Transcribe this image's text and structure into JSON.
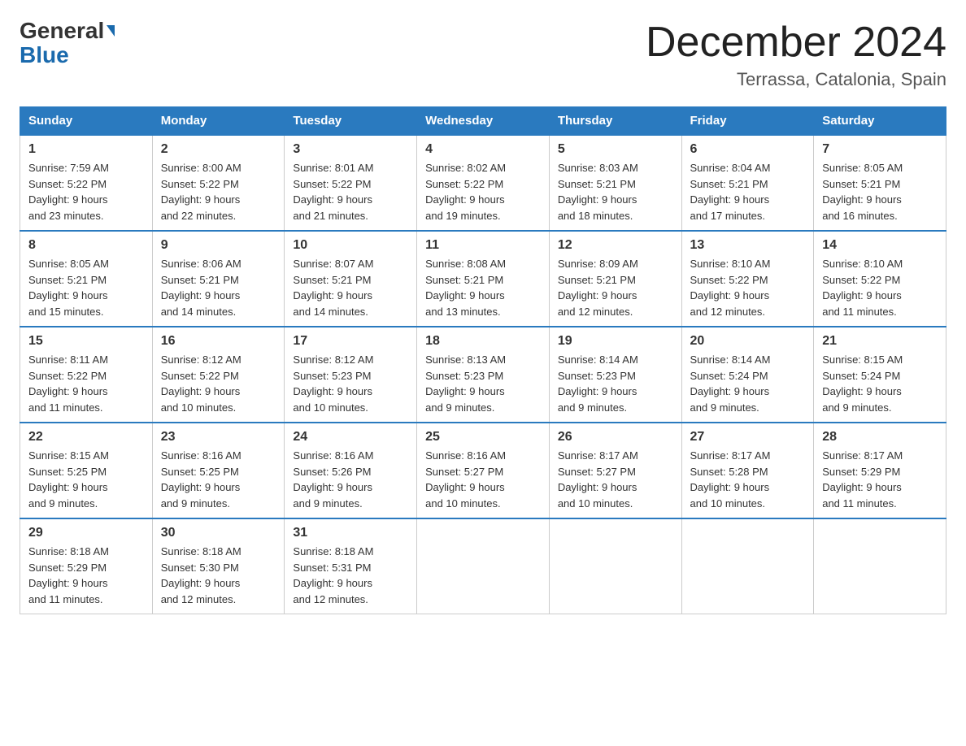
{
  "logo": {
    "line1": "General",
    "line2": "Blue"
  },
  "title": {
    "month_year": "December 2024",
    "location": "Terrassa, Catalonia, Spain"
  },
  "days_of_week": [
    "Sunday",
    "Monday",
    "Tuesday",
    "Wednesday",
    "Thursday",
    "Friday",
    "Saturday"
  ],
  "weeks": [
    [
      {
        "num": "1",
        "info": "Sunrise: 7:59 AM\nSunset: 5:22 PM\nDaylight: 9 hours\nand 23 minutes."
      },
      {
        "num": "2",
        "info": "Sunrise: 8:00 AM\nSunset: 5:22 PM\nDaylight: 9 hours\nand 22 minutes."
      },
      {
        "num": "3",
        "info": "Sunrise: 8:01 AM\nSunset: 5:22 PM\nDaylight: 9 hours\nand 21 minutes."
      },
      {
        "num": "4",
        "info": "Sunrise: 8:02 AM\nSunset: 5:22 PM\nDaylight: 9 hours\nand 19 minutes."
      },
      {
        "num": "5",
        "info": "Sunrise: 8:03 AM\nSunset: 5:21 PM\nDaylight: 9 hours\nand 18 minutes."
      },
      {
        "num": "6",
        "info": "Sunrise: 8:04 AM\nSunset: 5:21 PM\nDaylight: 9 hours\nand 17 minutes."
      },
      {
        "num": "7",
        "info": "Sunrise: 8:05 AM\nSunset: 5:21 PM\nDaylight: 9 hours\nand 16 minutes."
      }
    ],
    [
      {
        "num": "8",
        "info": "Sunrise: 8:05 AM\nSunset: 5:21 PM\nDaylight: 9 hours\nand 15 minutes."
      },
      {
        "num": "9",
        "info": "Sunrise: 8:06 AM\nSunset: 5:21 PM\nDaylight: 9 hours\nand 14 minutes."
      },
      {
        "num": "10",
        "info": "Sunrise: 8:07 AM\nSunset: 5:21 PM\nDaylight: 9 hours\nand 14 minutes."
      },
      {
        "num": "11",
        "info": "Sunrise: 8:08 AM\nSunset: 5:21 PM\nDaylight: 9 hours\nand 13 minutes."
      },
      {
        "num": "12",
        "info": "Sunrise: 8:09 AM\nSunset: 5:21 PM\nDaylight: 9 hours\nand 12 minutes."
      },
      {
        "num": "13",
        "info": "Sunrise: 8:10 AM\nSunset: 5:22 PM\nDaylight: 9 hours\nand 12 minutes."
      },
      {
        "num": "14",
        "info": "Sunrise: 8:10 AM\nSunset: 5:22 PM\nDaylight: 9 hours\nand 11 minutes."
      }
    ],
    [
      {
        "num": "15",
        "info": "Sunrise: 8:11 AM\nSunset: 5:22 PM\nDaylight: 9 hours\nand 11 minutes."
      },
      {
        "num": "16",
        "info": "Sunrise: 8:12 AM\nSunset: 5:22 PM\nDaylight: 9 hours\nand 10 minutes."
      },
      {
        "num": "17",
        "info": "Sunrise: 8:12 AM\nSunset: 5:23 PM\nDaylight: 9 hours\nand 10 minutes."
      },
      {
        "num": "18",
        "info": "Sunrise: 8:13 AM\nSunset: 5:23 PM\nDaylight: 9 hours\nand 9 minutes."
      },
      {
        "num": "19",
        "info": "Sunrise: 8:14 AM\nSunset: 5:23 PM\nDaylight: 9 hours\nand 9 minutes."
      },
      {
        "num": "20",
        "info": "Sunrise: 8:14 AM\nSunset: 5:24 PM\nDaylight: 9 hours\nand 9 minutes."
      },
      {
        "num": "21",
        "info": "Sunrise: 8:15 AM\nSunset: 5:24 PM\nDaylight: 9 hours\nand 9 minutes."
      }
    ],
    [
      {
        "num": "22",
        "info": "Sunrise: 8:15 AM\nSunset: 5:25 PM\nDaylight: 9 hours\nand 9 minutes."
      },
      {
        "num": "23",
        "info": "Sunrise: 8:16 AM\nSunset: 5:25 PM\nDaylight: 9 hours\nand 9 minutes."
      },
      {
        "num": "24",
        "info": "Sunrise: 8:16 AM\nSunset: 5:26 PM\nDaylight: 9 hours\nand 9 minutes."
      },
      {
        "num": "25",
        "info": "Sunrise: 8:16 AM\nSunset: 5:27 PM\nDaylight: 9 hours\nand 10 minutes."
      },
      {
        "num": "26",
        "info": "Sunrise: 8:17 AM\nSunset: 5:27 PM\nDaylight: 9 hours\nand 10 minutes."
      },
      {
        "num": "27",
        "info": "Sunrise: 8:17 AM\nSunset: 5:28 PM\nDaylight: 9 hours\nand 10 minutes."
      },
      {
        "num": "28",
        "info": "Sunrise: 8:17 AM\nSunset: 5:29 PM\nDaylight: 9 hours\nand 11 minutes."
      }
    ],
    [
      {
        "num": "29",
        "info": "Sunrise: 8:18 AM\nSunset: 5:29 PM\nDaylight: 9 hours\nand 11 minutes."
      },
      {
        "num": "30",
        "info": "Sunrise: 8:18 AM\nSunset: 5:30 PM\nDaylight: 9 hours\nand 12 minutes."
      },
      {
        "num": "31",
        "info": "Sunrise: 8:18 AM\nSunset: 5:31 PM\nDaylight: 9 hours\nand 12 minutes."
      },
      null,
      null,
      null,
      null
    ]
  ]
}
